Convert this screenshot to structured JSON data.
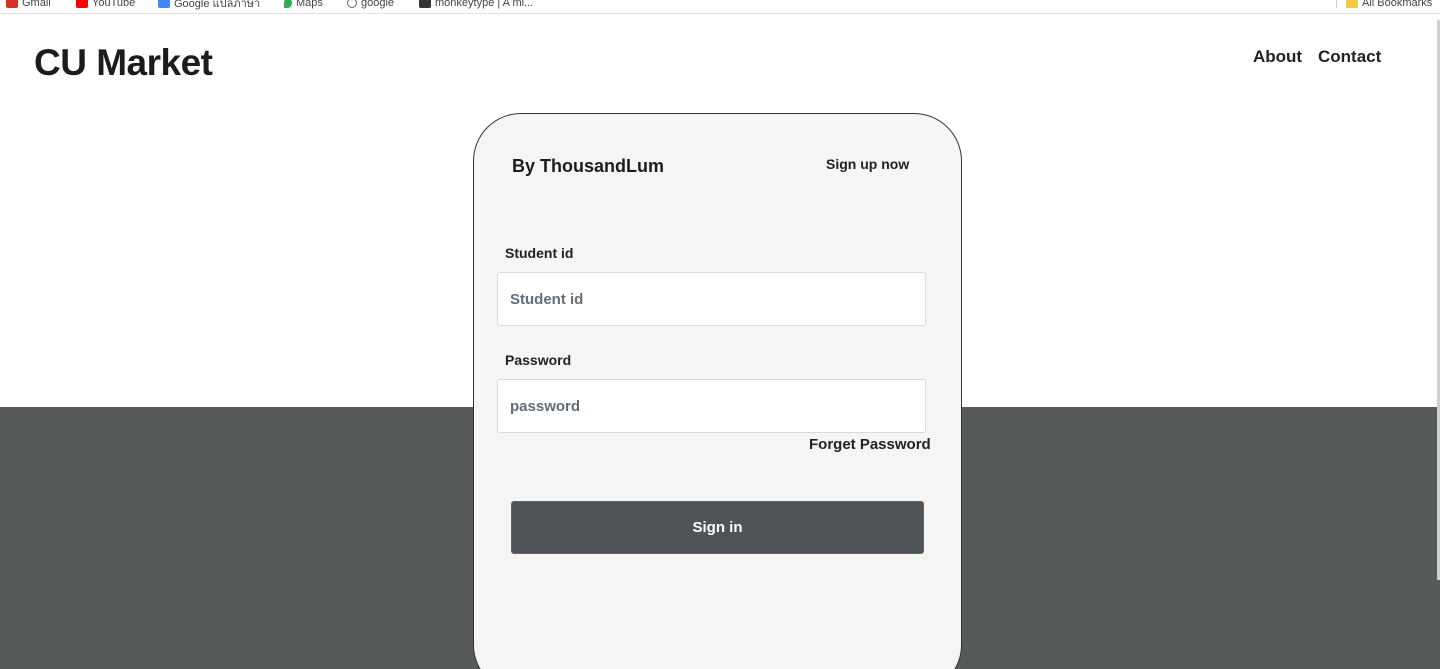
{
  "bookmarks": [
    {
      "label": "Gmail",
      "icon": "gmail-icon",
      "color": "#d93025"
    },
    {
      "label": "YouTube",
      "icon": "youtube-icon",
      "color": "#ff0000"
    },
    {
      "label": "Google แปลภาษา",
      "icon": "translate-icon",
      "color": "#4285f4"
    },
    {
      "label": "Maps",
      "icon": "maps-icon",
      "color": "#34a853"
    },
    {
      "label": "google",
      "icon": "globe-icon",
      "color": "#5f6368"
    },
    {
      "label": "monkeytype | A mi...",
      "icon": "monkeytype-icon",
      "color": "#323437"
    }
  ],
  "all_bookmarks": {
    "label": "All Bookmarks",
    "icon": "folder-icon",
    "color": "#f2c744"
  },
  "header": {
    "title": "CU Market",
    "nav": [
      "About",
      "Contact"
    ]
  },
  "card": {
    "brand": "By ThousandLum",
    "signup_link": "Sign up now",
    "student_label": "Student id",
    "student_placeholder": "Student id",
    "password_label": "Password",
    "password_placeholder": "password",
    "forget_link": "Forget Password",
    "signin_label": "Sign in"
  },
  "colors": {
    "dark_band": "#575a5b",
    "button_bg": "#4f5356",
    "card_bg": "#f5f5f5"
  }
}
